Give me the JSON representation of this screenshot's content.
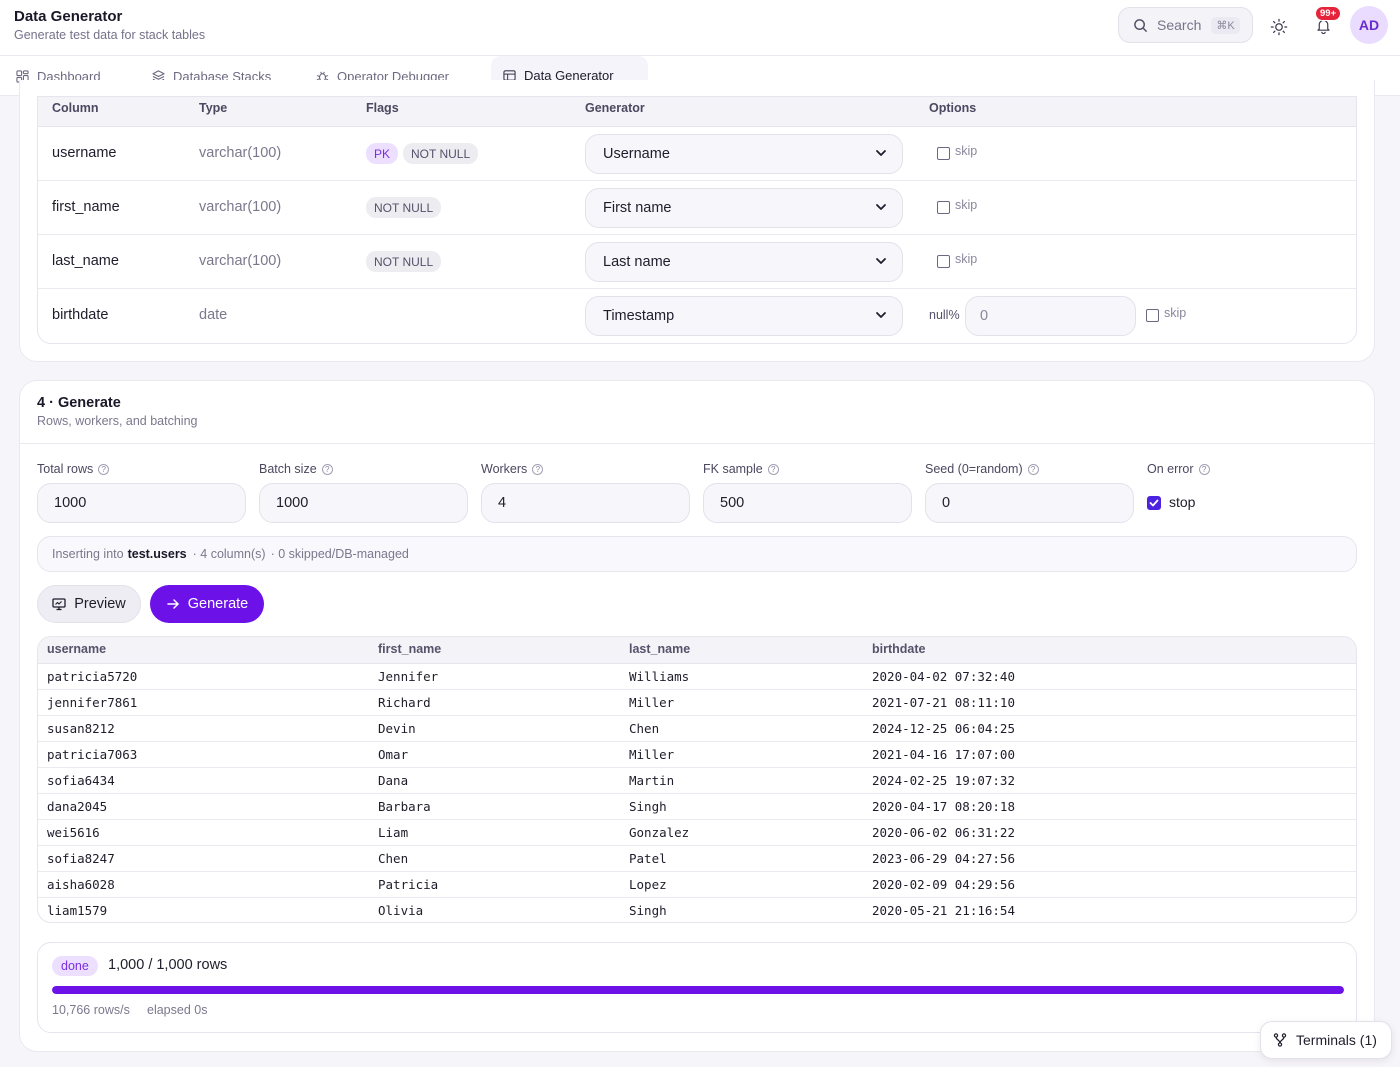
{
  "header": {
    "title": "Data Generator",
    "subtitle": "Generate test data for stack tables",
    "search_placeholder": "Search",
    "search_shortcut": "⌘K",
    "notifications_count": "99+",
    "avatar_initials": "AD"
  },
  "tabs": [
    {
      "label": "Dashboard",
      "icon": "dashboard-icon"
    },
    {
      "label": "Database Stacks",
      "icon": "layers-icon"
    },
    {
      "label": "Operator Debugger",
      "icon": "bug-icon"
    },
    {
      "label": "Data Generator",
      "icon": "table-icon",
      "active": true
    }
  ],
  "columns_table": {
    "headers": [
      "Column",
      "Type",
      "Flags",
      "Generator",
      "Options"
    ],
    "rows": [
      {
        "column": "username",
        "type": "varchar(100)",
        "flags": [
          "PK",
          "NOT NULL"
        ],
        "generator": "Username",
        "skip_label": "skip"
      },
      {
        "column": "first_name",
        "type": "varchar(100)",
        "flags": [
          "NOT NULL"
        ],
        "generator": "First name",
        "skip_label": "skip"
      },
      {
        "column": "last_name",
        "type": "varchar(100)",
        "flags": [
          "NOT NULL"
        ],
        "generator": "Last name",
        "skip_label": "skip"
      },
      {
        "column": "birthdate",
        "type": "date",
        "flags": [],
        "generator": "Timestamp",
        "null_label": "null%",
        "null_value": "0",
        "skip_label": "skip"
      }
    ]
  },
  "generate": {
    "title": "4 · Generate",
    "subtitle": "Rows, workers, and batching",
    "fields": [
      {
        "label": "Total rows",
        "value": "1000"
      },
      {
        "label": "Batch size",
        "value": "1000"
      },
      {
        "label": "Workers",
        "value": "4"
      },
      {
        "label": "FK sample",
        "value": "500"
      },
      {
        "label": "Seed (0=random)",
        "value": "0"
      }
    ],
    "on_error_label": "On error",
    "on_error_option": "stop",
    "info": {
      "prefix": "Inserting into",
      "table": "test.users",
      "columns": "· 4 column(s)",
      "skipped": "· 0 skipped/DB-managed"
    },
    "preview_label": "Preview",
    "generate_label": "Generate"
  },
  "preview_table": {
    "headers": [
      "username",
      "first_name",
      "last_name",
      "birthdate"
    ],
    "rows": [
      [
        "patricia5720",
        "Jennifer",
        "Williams",
        "2020-04-02 07:32:40"
      ],
      [
        "jennifer7861",
        "Richard",
        "Miller",
        "2021-07-21 08:11:10"
      ],
      [
        "susan8212",
        "Devin",
        "Chen",
        "2024-12-25 06:04:25"
      ],
      [
        "patricia7063",
        "Omar",
        "Miller",
        "2021-04-16 17:07:00"
      ],
      [
        "sofia6434",
        "Dana",
        "Martin",
        "2024-02-25 19:07:32"
      ],
      [
        "dana2045",
        "Barbara",
        "Singh",
        "2020-04-17 08:20:18"
      ],
      [
        "wei5616",
        "Liam",
        "Gonzalez",
        "2020-06-02 06:31:22"
      ],
      [
        "sofia8247",
        "Chen",
        "Patel",
        "2023-06-29 04:27:56"
      ],
      [
        "aisha6028",
        "Patricia",
        "Lopez",
        "2020-02-09 04:29:56"
      ],
      [
        "liam1579",
        "Olivia",
        "Singh",
        "2020-05-21 21:16:54"
      ]
    ]
  },
  "progress": {
    "status": "done",
    "count": "1,000 / 1,000 rows",
    "fraction": 1.0,
    "rate": "10,766 rows/s",
    "elapsed": "elapsed 0s"
  },
  "terminals_label": "Terminals (1)",
  "colors": {
    "accent": "#6c12e8",
    "badge_bg": "#eddfff",
    "alert": "#e5243b"
  }
}
